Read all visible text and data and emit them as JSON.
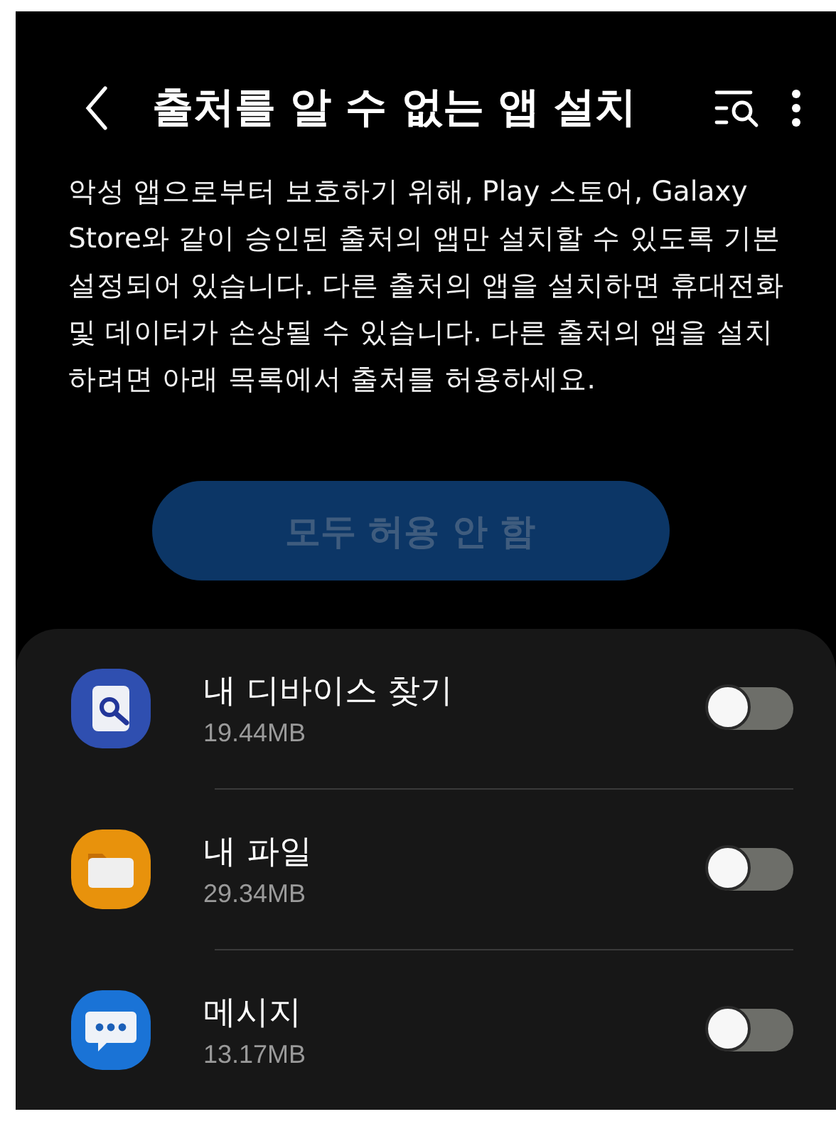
{
  "header": {
    "title": "출처를 알 수 없는 앱 설치"
  },
  "description": "악성 앱으로부터 보호하기 위해, Play 스토어, Galaxy Store와 같이 승인된 출처의 앱만 설치할 수 있도록 기본 설정되어 있습니다. 다른 출처의 앱을 설치하면 휴대전화 및 데이터가 손상될 수 있습니다. 다른 출처의 앱을 설치하려면 아래 목록에서 출처를 허용하세요.",
  "disallow_all_button": {
    "label": "모두 허용 안 함",
    "disabled": true
  },
  "apps": [
    {
      "name": "내 디바이스 찾기",
      "size": "19.44MB",
      "kind": "finder",
      "on": false
    },
    {
      "name": "내 파일",
      "size": "29.34MB",
      "kind": "files",
      "on": false
    },
    {
      "name": "메시지",
      "size": "13.17MB",
      "kind": "messages",
      "on": false
    }
  ]
}
